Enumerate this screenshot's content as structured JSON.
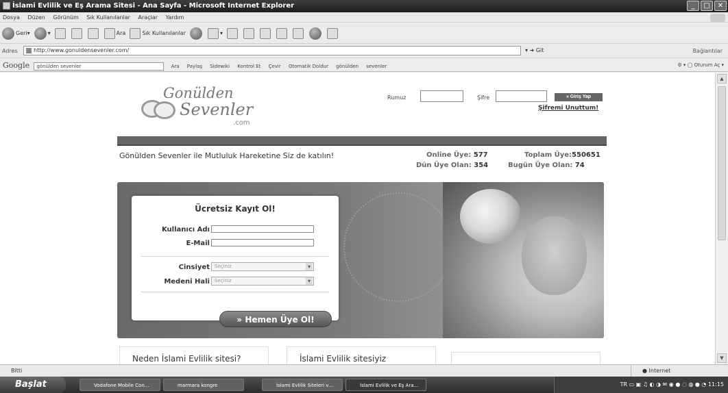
{
  "window": {
    "title": "İslami Evlilik ve Eş Arama Sitesi - Ana Sayfa - Microsoft Internet Explorer"
  },
  "menu": [
    "Dosya",
    "Düzen",
    "Görünüm",
    "Sık Kullanılanlar",
    "Araçlar",
    "Yardım"
  ],
  "toolbar": {
    "back": "Geri",
    "search": "Ara",
    "favorites": "Sık Kullanılanlar"
  },
  "address": {
    "label": "Adres",
    "url": "http://www.gonuldensevenler.com/",
    "go": "Git",
    "links": "Bağlantılar"
  },
  "googlebar": {
    "logo": "Google",
    "query": "gönülden sevenler",
    "items": [
      "Ara",
      "Paylaş",
      "Sidewiki",
      "Kontrol Et",
      "Çevir",
      "Otomatik Doldur",
      "gönülden",
      "sevenler"
    ],
    "signin": "Oturum Aç"
  },
  "site": {
    "logo_line1": "Gonülden",
    "logo_line2": "Sevenler",
    "logo_domain": ".com",
    "login": {
      "user_label": "Rumuz",
      "pass_label": "Şifre",
      "button": "Giriş Yap",
      "forgot": "Şifremi Unuttum!"
    },
    "slogan": "Gönülden Sevenler ile Mutluluk Hareketine Siz de katılın!",
    "stats": {
      "online_label": "Online Üye:",
      "online_value": "577",
      "total_label": "Toplam Üye:",
      "total_value": "550651",
      "yesterday_label": "Dün Üye Olan:",
      "yesterday_value": "354",
      "today_label": "Bugün Üye Olan:",
      "today_value": "74"
    },
    "form": {
      "title": "Ücretsiz Kayıt Ol!",
      "username_label": "Kullanıcı Adı",
      "email_label": "E-Mail",
      "gender_label": "Cinsiyet",
      "gender_value": "Seçiniz",
      "marital_label": "Medeni Hali",
      "marital_value": "Seçiniz",
      "submit": "» Hemen Üye Ol!"
    },
    "boxes": [
      "Neden İslami Evlilik sitesi?",
      "İslami Evlilik sitesiyiz",
      ""
    ]
  },
  "status": {
    "left": "Bitti",
    "zone": "Internet"
  },
  "taskbar": {
    "start": "Başlat",
    "tasks": [
      "Vodafone Mobile Con...",
      "marmara kongre",
      "İslami Evlilik Siteleri v...",
      "İslami Evlilik ve Eş Ara..."
    ],
    "clock": "11:15",
    "lang": "TR"
  }
}
